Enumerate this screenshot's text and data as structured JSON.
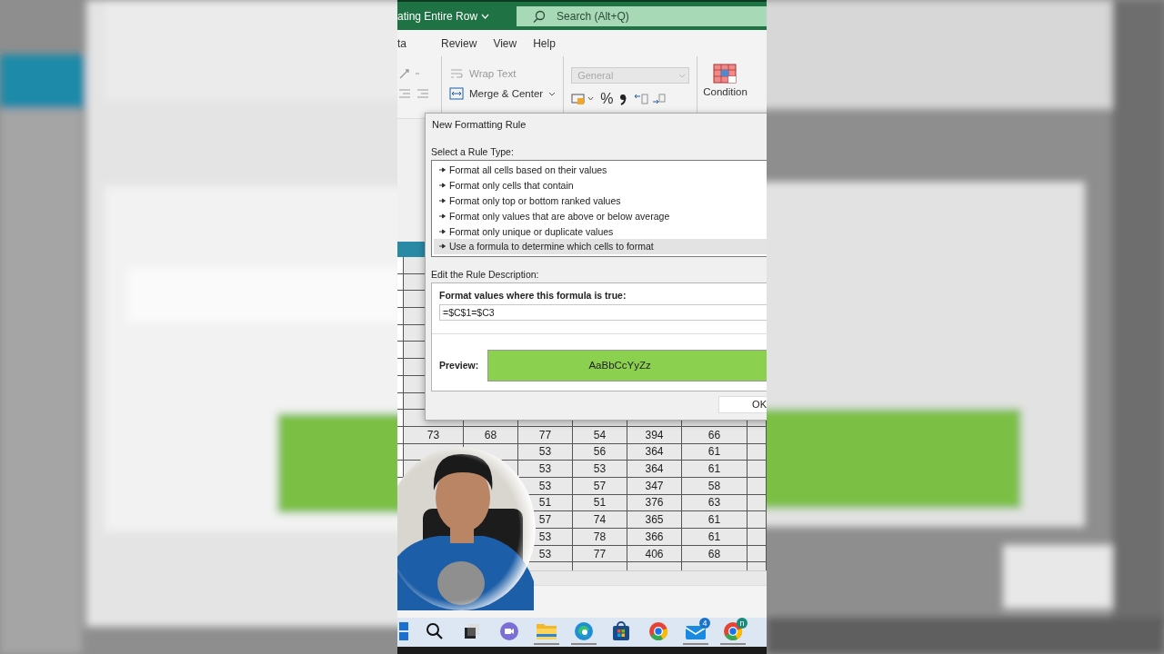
{
  "title_bar": {
    "title": "ating Entire Row",
    "search": {
      "placeholder": "Search (Alt+Q)"
    }
  },
  "menu": [
    {
      "label": "ta"
    },
    {
      "label": "Review"
    },
    {
      "label": "View"
    },
    {
      "label": "Help"
    }
  ],
  "ribbon": {
    "wrap_text": "Wrap Text",
    "merge_center": "Merge & Center",
    "number_format": {
      "value": "General",
      "disabled": true
    },
    "percent": "%",
    "conditional": "Condition"
  },
  "sheet": {
    "rows": [
      {
        "cells": [
          "73",
          "68",
          "77",
          "54",
          "394",
          "66"
        ]
      },
      {
        "cells": [
          "",
          "",
          "53",
          "56",
          "364",
          "61"
        ]
      },
      {
        "cells": [
          "",
          "",
          "53",
          "53",
          "364",
          "61"
        ]
      },
      {
        "cells": [
          "",
          "",
          "53",
          "57",
          "347",
          "58"
        ]
      },
      {
        "cells": [
          "",
          "",
          "51",
          "51",
          "376",
          "63"
        ]
      },
      {
        "cells": [
          "",
          "",
          "57",
          "74",
          "365",
          "61"
        ]
      },
      {
        "cells": [
          "",
          "",
          "53",
          "78",
          "366",
          "61"
        ]
      },
      {
        "cells": [
          "",
          "",
          "53",
          "77",
          "406",
          "68"
        ]
      }
    ]
  },
  "dialog": {
    "title": "New Formatting Rule",
    "rule_type_label": "Select a Rule Type:",
    "rule_types": [
      {
        "label": "Format all cells based on their values",
        "selected": false
      },
      {
        "label": "Format only cells that contain",
        "selected": false
      },
      {
        "label": "Format only top or bottom ranked values",
        "selected": false
      },
      {
        "label": "Format only values that are above or below average",
        "selected": false
      },
      {
        "label": "Format only unique or duplicate values",
        "selected": false
      },
      {
        "label": "Use a formula to determine which cells to format",
        "selected": true
      }
    ],
    "description_label": "Edit the Rule Description:",
    "formula_label": "Format values where this formula is true:",
    "formula": "=$C$1=$C3",
    "preview": {
      "label": "Preview:",
      "text": "AaBbCcYyZz",
      "color": "#8cd04f"
    },
    "ok": "OK"
  },
  "taskbar": [
    {
      "kind": "start",
      "running": false
    },
    {
      "kind": "search",
      "running": false
    },
    {
      "kind": "taskview",
      "running": false
    },
    {
      "kind": "chat",
      "running": false
    },
    {
      "kind": "explorer",
      "running": true
    },
    {
      "kind": "edge",
      "running": true
    },
    {
      "kind": "store",
      "running": false
    },
    {
      "kind": "chrome",
      "running": false
    },
    {
      "kind": "mail",
      "running": true,
      "badge": "4"
    },
    {
      "kind": "chrome",
      "running": true,
      "badge": "n"
    }
  ]
}
